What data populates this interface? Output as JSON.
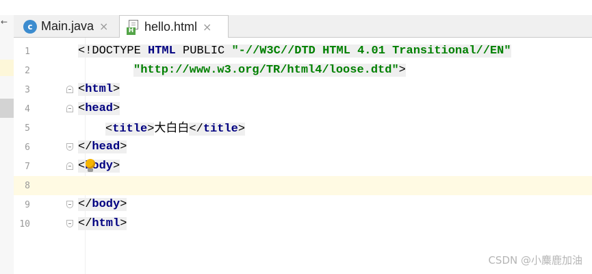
{
  "tabs": [
    {
      "label": "Main.java",
      "icon": "c-class-icon",
      "close": "×"
    },
    {
      "label": "hello.html",
      "icon": "html-file-icon",
      "close": "×"
    }
  ],
  "left_panel": {
    "arrow": "←"
  },
  "editor": {
    "line_numbers": [
      "1",
      "2",
      "3",
      "4",
      "5",
      "6",
      "7",
      "8",
      "9",
      "10"
    ],
    "doctype": {
      "open": "<!DOCTYPE ",
      "html": "HTML",
      "public": " PUBLIC ",
      "dtd": "\"-//W3C//DTD HTML 4.01 Transitional//EN\"",
      "url": "\"http://www.w3.org/TR/html4/loose.dtd\"",
      "close": ">"
    },
    "tags": {
      "html": "html",
      "head": "head",
      "title": "title",
      "body": "body"
    },
    "title_text": "大白白",
    "current_line": 8
  },
  "colors": {
    "keyword": "#000080",
    "string": "#008000",
    "current_line": "#fffae3",
    "tag_background": "#efefef"
  },
  "watermark": "CSDN @小麋鹿加油"
}
